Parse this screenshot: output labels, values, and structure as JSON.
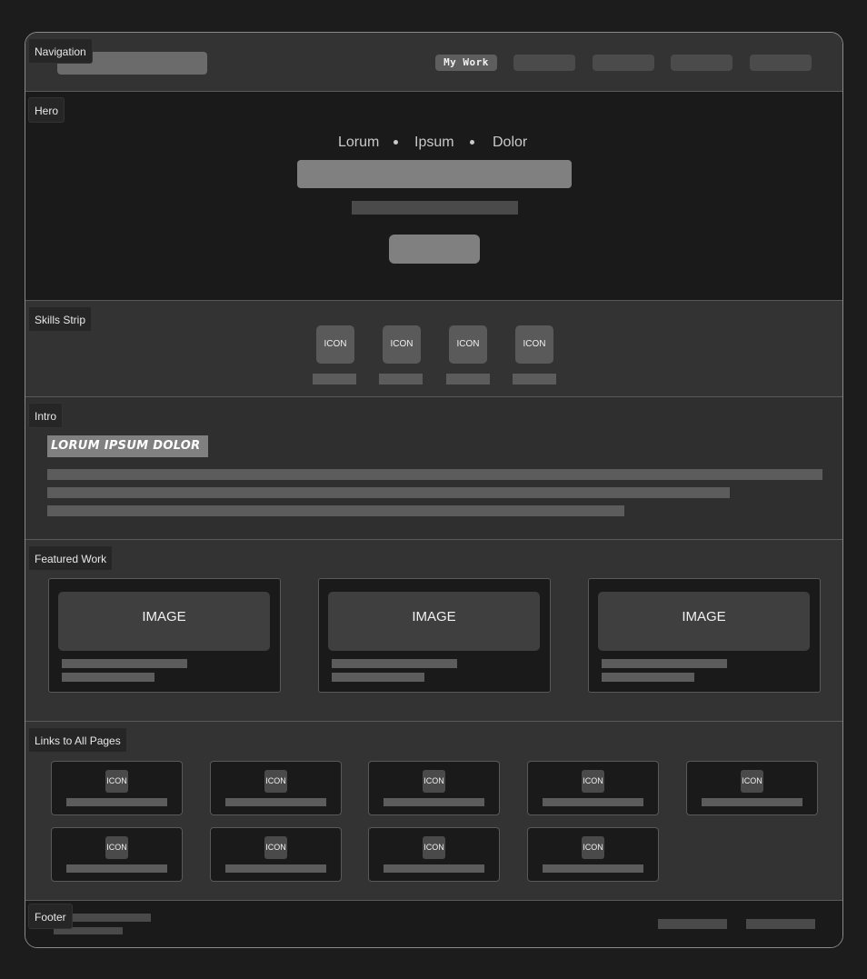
{
  "sections": {
    "navigation": "Navigation",
    "hero": "Hero",
    "skills": "Skills Strip",
    "intro": "Intro",
    "work": "Featured Work",
    "links": "Links to All Pages",
    "footer": "Footer"
  },
  "nav": {
    "active_link": "My Work"
  },
  "hero": {
    "words": [
      "Lorum",
      "Ipsum",
      "Dolor"
    ]
  },
  "skills": {
    "icon_label": "ICON"
  },
  "intro": {
    "heading": "LORUM IPSUM DOLOR"
  },
  "work": {
    "image_label": "IMAGE"
  },
  "links": {
    "icon_label": "ICON"
  }
}
